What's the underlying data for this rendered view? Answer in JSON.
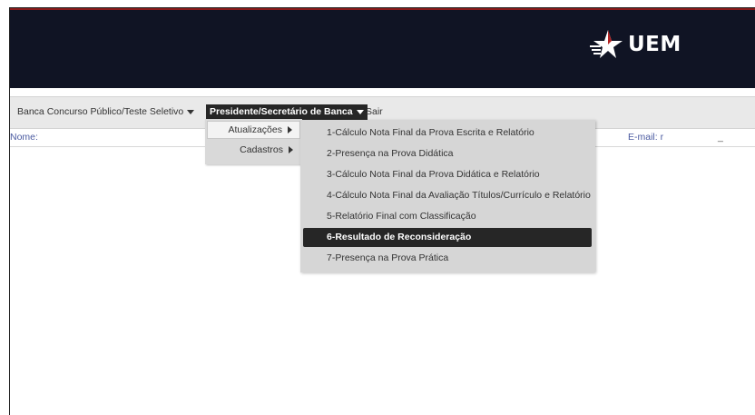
{
  "header": {
    "logo_text": "UEM",
    "colors": {
      "background": "#101424",
      "logo": "#ffffff"
    }
  },
  "menubar": {
    "items": [
      {
        "label": "Banca Concurso Público/Teste Seletivo",
        "icon": "chevron-down-icon"
      },
      {
        "label": "Presidente/Secretário de Banca",
        "icon": "chevron-down-icon",
        "active": true
      },
      {
        "label": "Sair"
      }
    ]
  },
  "infobar": {
    "name_label": "Nome:",
    "email_label": "E-mail: r",
    "extra": "_"
  },
  "submenu": {
    "items": [
      {
        "label": "Atualizações",
        "icon": "chevron-right-icon",
        "highlighted": true
      },
      {
        "label": "Cadastros",
        "icon": "chevron-right-icon"
      }
    ]
  },
  "atualizacoes_menu": {
    "items": [
      {
        "label": "1-Cálculo Nota Final da Prova Escrita e Relatório"
      },
      {
        "label": "2-Presença na Prova Didática"
      },
      {
        "label": "3-Cálculo Nota Final da Prova Didática e Relatório"
      },
      {
        "label": "4-Cálculo Nota Final da Avaliação Títulos/Currículo e Relatório"
      },
      {
        "label": "5-Relatório Final com Classificação"
      },
      {
        "label": "6-Resultado de Reconsideração",
        "highlighted": true
      },
      {
        "label": "7-Presença na Prova Prática"
      }
    ]
  }
}
